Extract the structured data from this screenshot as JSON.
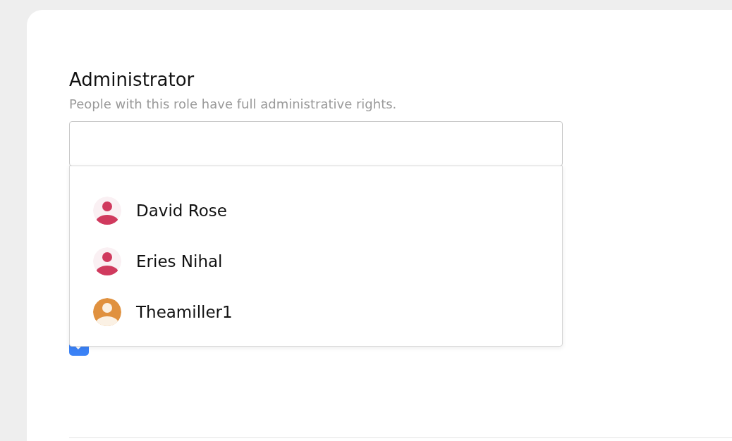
{
  "section": {
    "title": "Administrator",
    "description": "People with this role have full administrative rights."
  },
  "dropdown": {
    "options": [
      {
        "name": "David Rose",
        "kind": "outline",
        "color": "#d03a5e"
      },
      {
        "name": "Eries Nihal",
        "kind": "outline",
        "color": "#d03a5e"
      },
      {
        "name": "Theamiller1",
        "kind": "filled",
        "color": "#e0913f"
      }
    ]
  },
  "consent": {
    "checked": true
  }
}
